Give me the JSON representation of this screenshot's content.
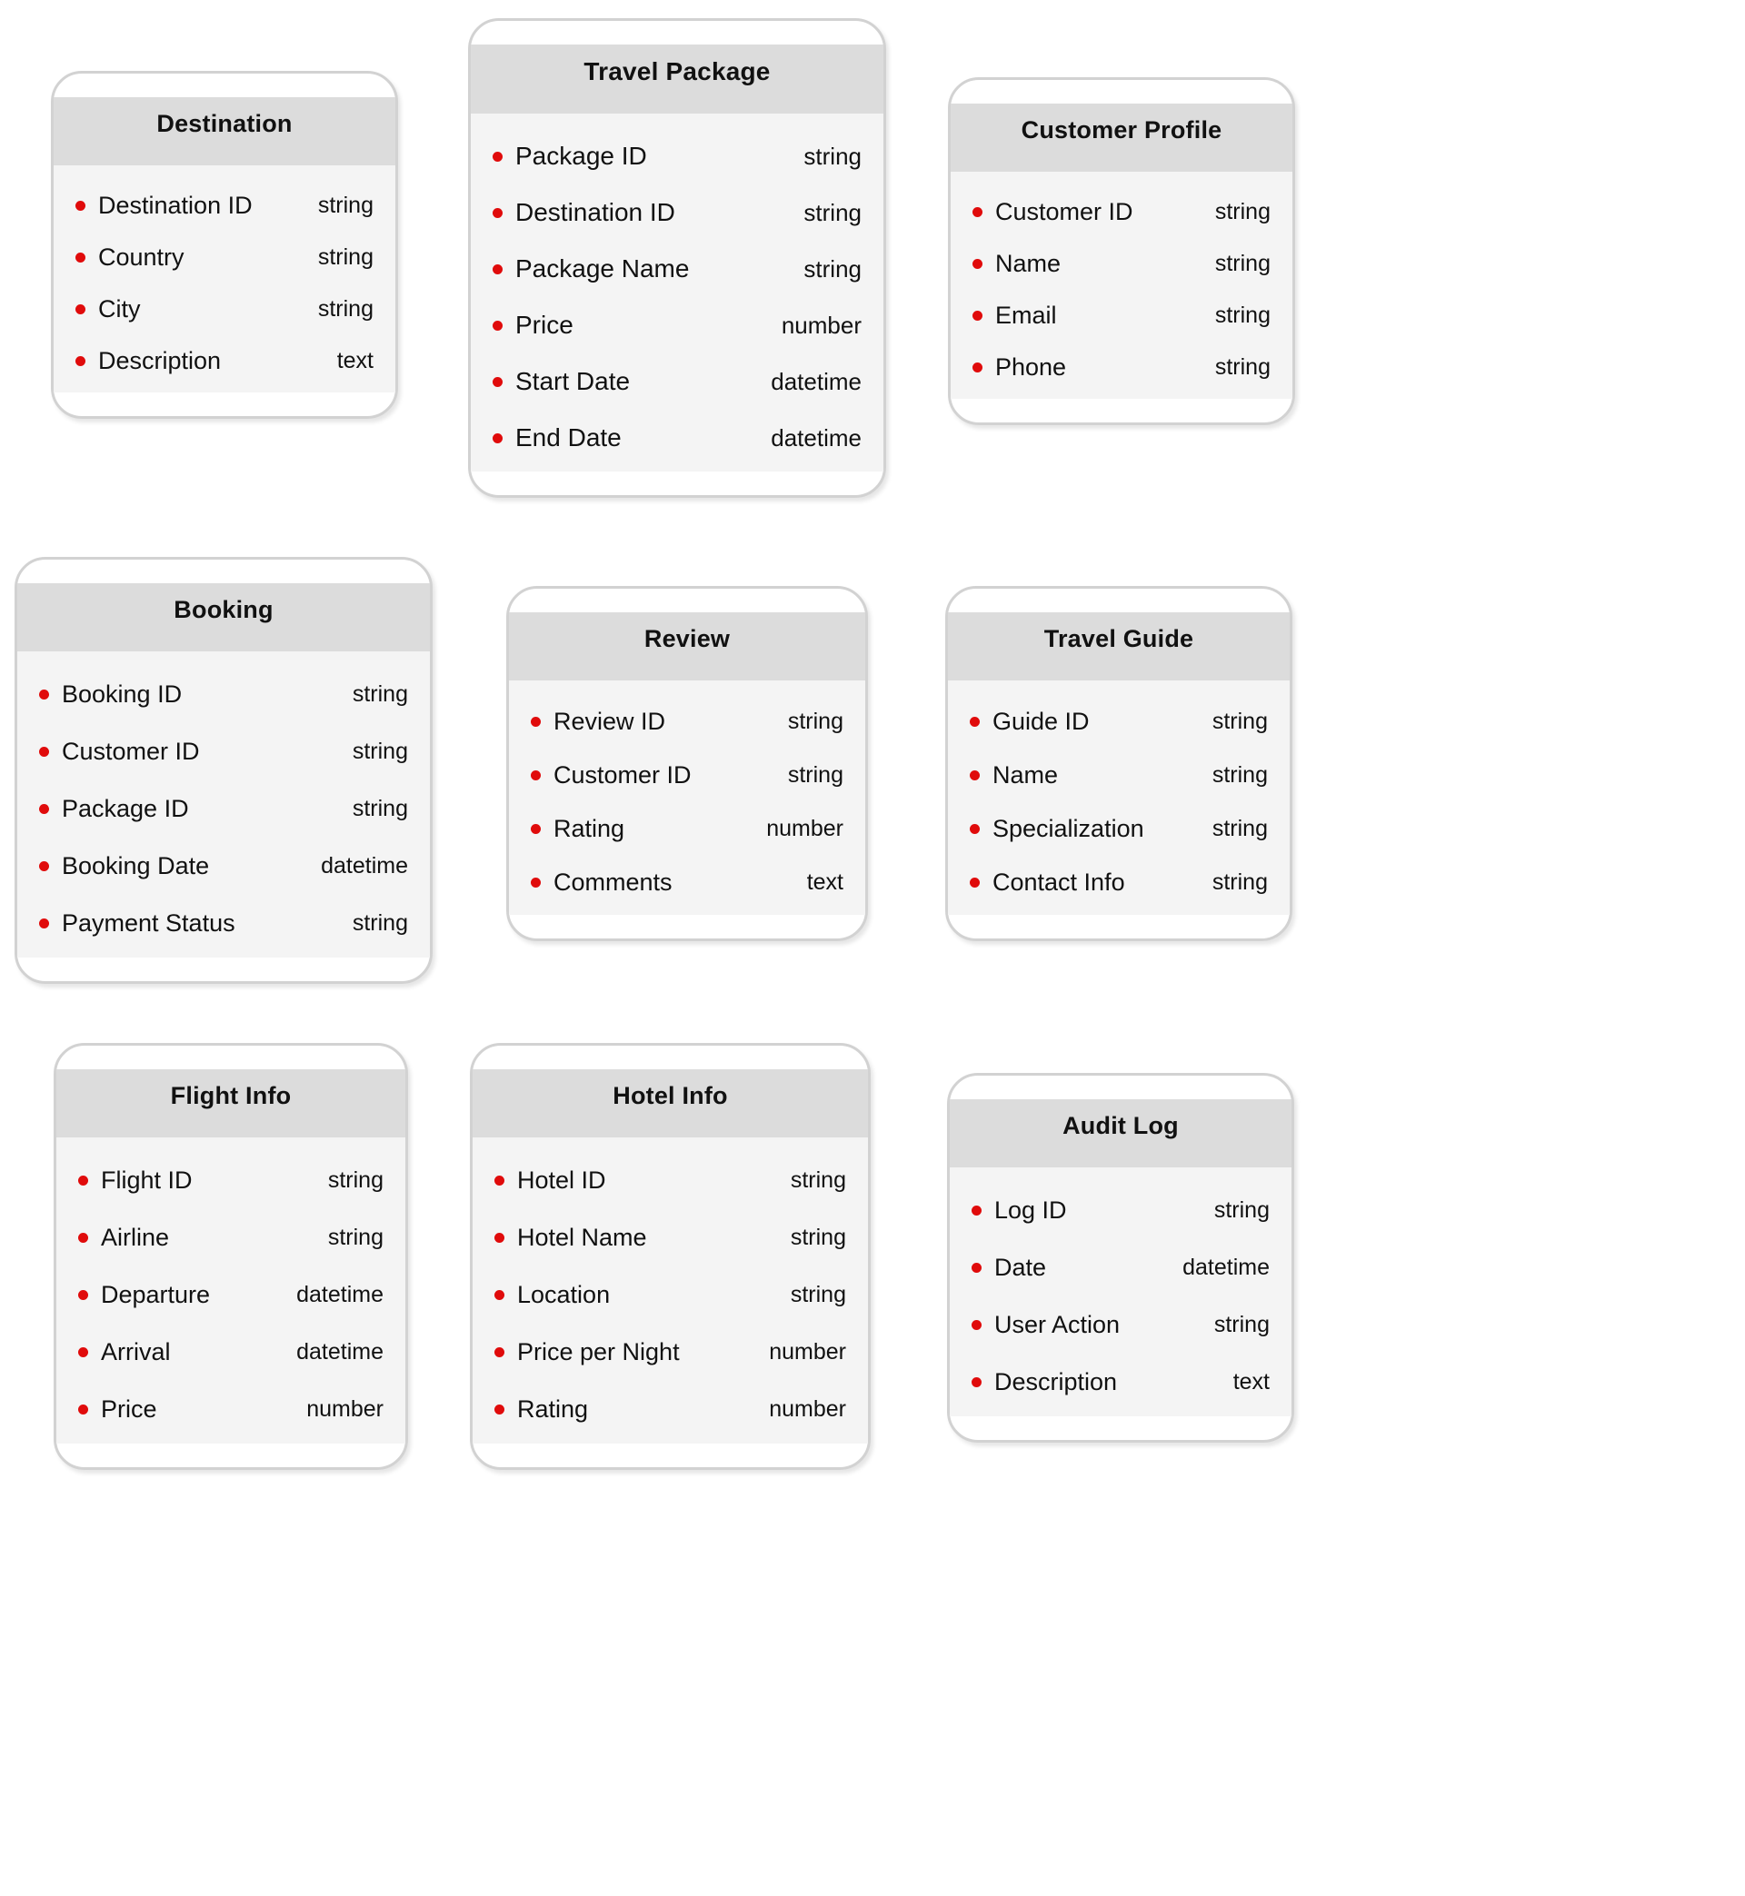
{
  "theme": {
    "bullet_color": "#e00b0b",
    "header_bg": "#dcdcdc",
    "body_bg": "#f4f4f4",
    "border_color": "#d2d2d2",
    "text_color": "#111111",
    "page_bg": "#ffffff"
  },
  "diagram": {
    "type": "entity-schema-card-grid",
    "entity_count": 9,
    "entities": [
      {
        "id": "destination",
        "title": "Destination",
        "attributes": [
          {
            "name": "Destination ID",
            "type": "string"
          },
          {
            "name": "Country",
            "type": "string"
          },
          {
            "name": "City",
            "type": "string"
          },
          {
            "name": "Description",
            "type": "text"
          }
        ]
      },
      {
        "id": "travel-package",
        "title": "Travel Package",
        "attributes": [
          {
            "name": "Package ID",
            "type": "string"
          },
          {
            "name": "Destination ID",
            "type": "string"
          },
          {
            "name": "Package Name",
            "type": "string"
          },
          {
            "name": "Price",
            "type": "number"
          },
          {
            "name": "Start Date",
            "type": "datetime"
          },
          {
            "name": "End Date",
            "type": "datetime"
          }
        ]
      },
      {
        "id": "customer-profile",
        "title": "Customer Profile",
        "attributes": [
          {
            "name": "Customer ID",
            "type": "string"
          },
          {
            "name": "Name",
            "type": "string"
          },
          {
            "name": "Email",
            "type": "string"
          },
          {
            "name": "Phone",
            "type": "string"
          }
        ]
      },
      {
        "id": "booking",
        "title": "Booking",
        "attributes": [
          {
            "name": "Booking ID",
            "type": "string"
          },
          {
            "name": "Customer ID",
            "type": "string"
          },
          {
            "name": "Package ID",
            "type": "string"
          },
          {
            "name": "Booking Date",
            "type": "datetime"
          },
          {
            "name": "Payment Status",
            "type": "string"
          }
        ]
      },
      {
        "id": "review",
        "title": "Review",
        "attributes": [
          {
            "name": "Review ID",
            "type": "string"
          },
          {
            "name": "Customer ID",
            "type": "string"
          },
          {
            "name": "Rating",
            "type": "number"
          },
          {
            "name": "Comments",
            "type": "text"
          }
        ]
      },
      {
        "id": "travel-guide",
        "title": "Travel Guide",
        "attributes": [
          {
            "name": "Guide ID",
            "type": "string"
          },
          {
            "name": "Name",
            "type": "string"
          },
          {
            "name": "Specialization",
            "type": "string"
          },
          {
            "name": "Contact Info",
            "type": "string"
          }
        ]
      },
      {
        "id": "flight-info",
        "title": "Flight Info",
        "attributes": [
          {
            "name": "Flight ID",
            "type": "string"
          },
          {
            "name": "Airline",
            "type": "string"
          },
          {
            "name": "Departure",
            "type": "datetime"
          },
          {
            "name": "Arrival",
            "type": "datetime"
          },
          {
            "name": "Price",
            "type": "number"
          }
        ]
      },
      {
        "id": "hotel-info",
        "title": "Hotel Info",
        "attributes": [
          {
            "name": "Hotel ID",
            "type": "string"
          },
          {
            "name": "Hotel Name",
            "type": "string"
          },
          {
            "name": "Location",
            "type": "string"
          },
          {
            "name": "Price per Night",
            "type": "number"
          },
          {
            "name": "Rating",
            "type": "number"
          }
        ]
      },
      {
        "id": "audit-log",
        "title": "Audit Log",
        "attributes": [
          {
            "name": "Log ID",
            "type": "string"
          },
          {
            "name": "Date",
            "type": "datetime"
          },
          {
            "name": "User Action",
            "type": "string"
          },
          {
            "name": "Description",
            "type": "text"
          }
        ]
      }
    ]
  }
}
